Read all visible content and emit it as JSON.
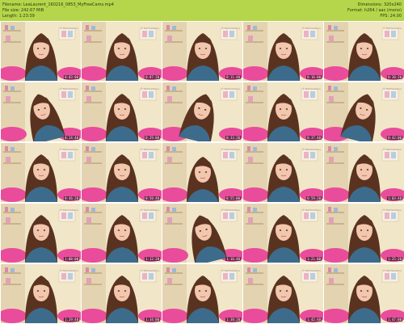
{
  "header": {
    "filename": "Filename: LeaLaurent_160216_0853_MyFreeCams.mp4",
    "file_size": "File size: 242.67 MiB",
    "length": "Length: 1:23:39",
    "dimensions": "Dimensions: 320x240",
    "format": "Format: h264 / aac (mono)",
    "fps": "FPS: 24.00",
    "bg_color": "#b5d64a"
  },
  "thumbnails": [
    {
      "time": "0:03:00",
      "pose": "center"
    },
    {
      "time": "0:07:20",
      "pose": "center"
    },
    {
      "time": "0:11:40",
      "pose": "center"
    },
    {
      "time": "0:16:00",
      "pose": "center"
    },
    {
      "time": "0:20:20",
      "pose": "center"
    },
    {
      "time": "0:24:40",
      "pose": "tilt-left"
    },
    {
      "time": "0:29:00",
      "pose": "center"
    },
    {
      "time": "0:33:20",
      "pose": "tilt-right"
    },
    {
      "time": "0:37:40",
      "pose": "center"
    },
    {
      "time": "0:42:00",
      "pose": "tilt-right"
    },
    {
      "time": "0:46:20",
      "pose": "center"
    },
    {
      "time": "0:50:40",
      "pose": "center"
    },
    {
      "time": "0:55:00",
      "pose": "down"
    },
    {
      "time": "0:59:20",
      "pose": "center"
    },
    {
      "time": "1:03:40",
      "pose": "center"
    },
    {
      "time": "1:08:00",
      "pose": "center"
    },
    {
      "time": "1:12:20",
      "pose": "center"
    },
    {
      "time": "1:16:40",
      "pose": "tilt-left"
    },
    {
      "time": "1:21:00",
      "pose": "center"
    },
    {
      "time": "1:25:20",
      "pose": "center"
    },
    {
      "time": "1:29:40",
      "pose": "center"
    },
    {
      "time": "1:34:00",
      "pose": "center"
    },
    {
      "time": "1:38:20",
      "pose": "center"
    },
    {
      "time": "1:42:40",
      "pose": "center"
    },
    {
      "time": "1:47:00",
      "pose": "center"
    }
  ],
  "watermark": "© MyFreeCams",
  "colors": {
    "wall": "#f1e6c8",
    "shelf": "#e9d8b5",
    "pillow": "#ea4c9c",
    "hair": "#5a3320",
    "skin": "#f2c7ad",
    "shirt": "#3d6b8c"
  }
}
